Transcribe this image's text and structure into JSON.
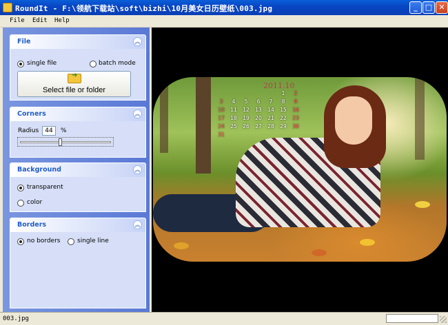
{
  "window": {
    "title": "RoundIt - F:\\领航下载站\\soft\\bizhi\\10月美女日历壁纸\\003.jpg",
    "controls": {
      "minimize": "_",
      "maximize": "□",
      "close": "✕"
    }
  },
  "menu": [
    "File",
    "Edit",
    "Help"
  ],
  "panels": {
    "file": {
      "title": "File",
      "collapse_icon": "chevron-up",
      "options": [
        "single file",
        "batch mode"
      ],
      "selected": "single file",
      "button_label": "Select file or folder"
    },
    "corners": {
      "title": "Corners",
      "radius_label": "Radius",
      "radius_value": "44",
      "unit": "%"
    },
    "background": {
      "title": "Background",
      "options": [
        "transparent",
        "color"
      ],
      "selected": "transparent"
    },
    "borders": {
      "title": "Borders",
      "options": [
        "no borders",
        "single line"
      ],
      "selected": "no borders"
    }
  },
  "preview": {
    "calendar_title": "2011.10",
    "calendar_weeks": [
      [
        "",
        "",
        "",
        "",
        "",
        "1",
        "2"
      ],
      [
        "3",
        "4",
        "5",
        "6",
        "7",
        "8",
        "9"
      ],
      [
        "10",
        "11",
        "12",
        "13",
        "14",
        "15",
        "16"
      ],
      [
        "17",
        "18",
        "19",
        "20",
        "21",
        "22",
        "23"
      ],
      [
        "24",
        "25",
        "26",
        "27",
        "28",
        "29",
        "30"
      ],
      [
        "31",
        "",
        "",
        "",
        "",
        "",
        ""
      ]
    ]
  },
  "status": {
    "filename": "003.jpg"
  }
}
